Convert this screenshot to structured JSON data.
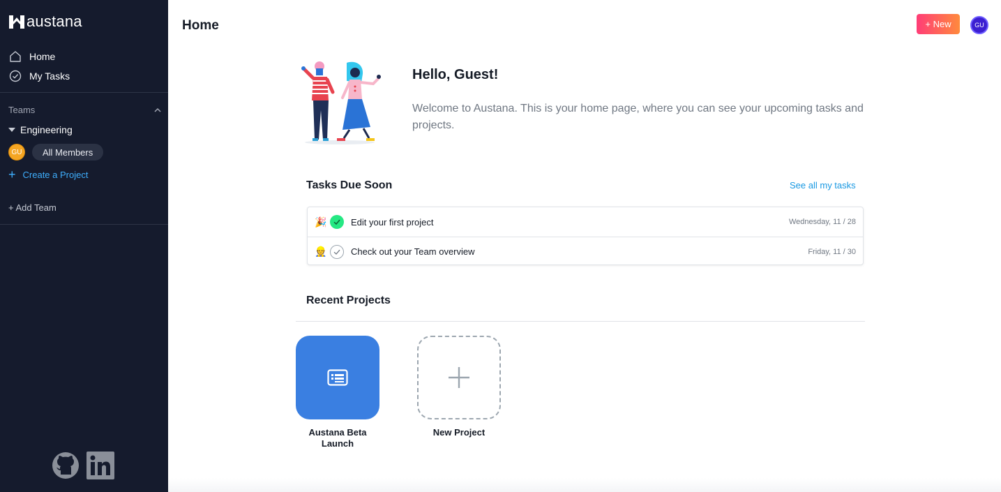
{
  "sidebar": {
    "brand": "austana",
    "nav": [
      {
        "label": "Home",
        "icon": "home-icon"
      },
      {
        "label": "My Tasks",
        "icon": "check-circle-icon"
      }
    ],
    "teams_heading": "Teams",
    "team_name": "Engineering",
    "member_initials": "GU",
    "all_members_label": "All Members",
    "create_project_label": "Create a Project",
    "add_team_label": "+ Add Team",
    "social": [
      "github-icon",
      "linkedin-icon"
    ]
  },
  "header": {
    "title": "Home",
    "new_button_label": "+ New",
    "user_initials": "GU"
  },
  "greeting": {
    "title": "Hello, Guest!",
    "message": "Welcome to Austana. This is your home page, where you can see your upcoming tasks and projects."
  },
  "tasks": {
    "heading": "Tasks Due Soon",
    "see_all_label": "See all my tasks",
    "items": [
      {
        "emoji": "🎉",
        "name": "Edit your first project",
        "due": "Wednesday, 11 / 28",
        "completed": true
      },
      {
        "emoji": "👷",
        "name": "Check out your Team overview",
        "due": "Friday, 11 / 30",
        "completed": false
      }
    ]
  },
  "projects": {
    "heading": "Recent Projects",
    "items": [
      {
        "name": "Austana Beta Launch",
        "icon": "project-list-icon",
        "color": "#3a7fe1"
      }
    ],
    "new_project_label": "New Project"
  },
  "colors": {
    "sidebar_bg": "#151b2d",
    "accent_link": "#1898e2",
    "new_button_gradient": [
      "#ff3d77",
      "#ff8a3d"
    ],
    "task_done": "#25e883",
    "avatar_top": "#3c1fd1",
    "avatar_member": "#f5a623"
  }
}
